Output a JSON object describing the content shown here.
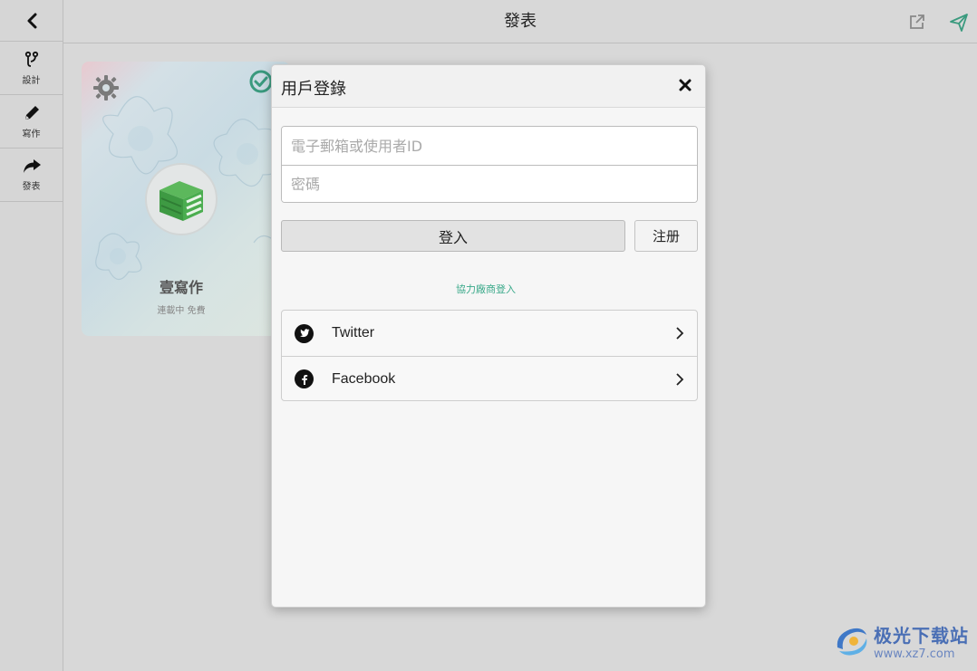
{
  "sidebar": {
    "items": [
      {
        "label": "設計",
        "icon": "branch-icon"
      },
      {
        "label": "寫作",
        "icon": "pencil-icon"
      },
      {
        "label": "發表",
        "icon": "share-arrow-icon"
      }
    ]
  },
  "topbar": {
    "title": "發表"
  },
  "card": {
    "title": "壹寫作",
    "subtitle": "連載中 免費"
  },
  "dialog": {
    "title": "用戶登錄",
    "email_placeholder": "電子郵箱或使用者ID",
    "password_placeholder": "密碼",
    "login_label": "登入",
    "register_label": "注册",
    "partner_label": "協力廠商登入",
    "providers": [
      {
        "label": "Twitter",
        "icon": "twitter-icon"
      },
      {
        "label": "Facebook",
        "icon": "facebook-icon"
      }
    ]
  },
  "watermark": {
    "title": "极光下载站",
    "url": "www.xz7.com"
  },
  "colors": {
    "accent": "#3aa98a",
    "send_icon": "#3a9a7e"
  }
}
